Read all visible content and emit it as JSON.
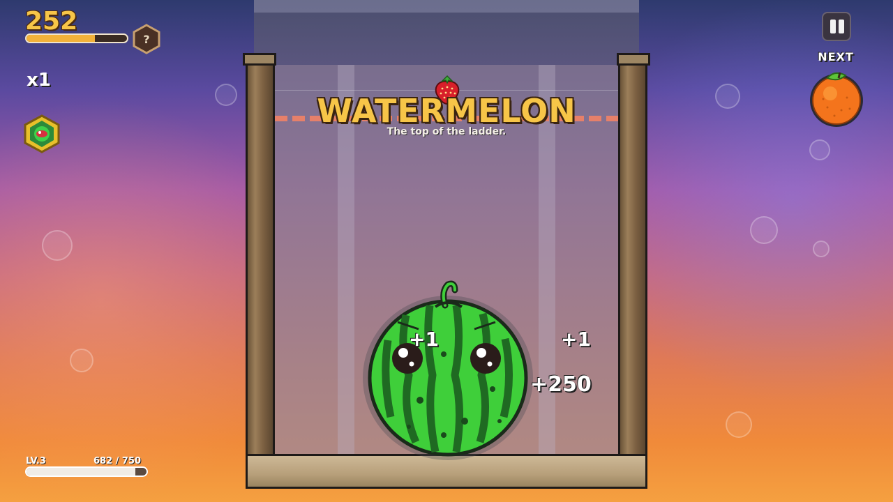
{
  "hud": {
    "score": "252",
    "score_progress": 0.68,
    "mystery_label": "?",
    "multiplier": "x1",
    "powerup_icon": "gem-hexagon-icon",
    "level": {
      "label": "LV.3",
      "xp": "682 / 750",
      "progress": 0.909
    }
  },
  "next": {
    "label": "NEXT",
    "fruit": "orange"
  },
  "pause": {
    "icon": "pause-icon"
  },
  "merge_banner": {
    "icon": "strawberry",
    "title": "WATERMELON",
    "subtitle": "The top of the ladder."
  },
  "board": {
    "fruit": "watermelon"
  },
  "popups": [
    "+1",
    "+1",
    "+250"
  ],
  "colors": {
    "score_gold": "#f7c548",
    "wood": "#9c7f5a",
    "deadline": "#e6806a",
    "watermelon_green": "#3fcf3a",
    "orange": "#f4741c"
  }
}
